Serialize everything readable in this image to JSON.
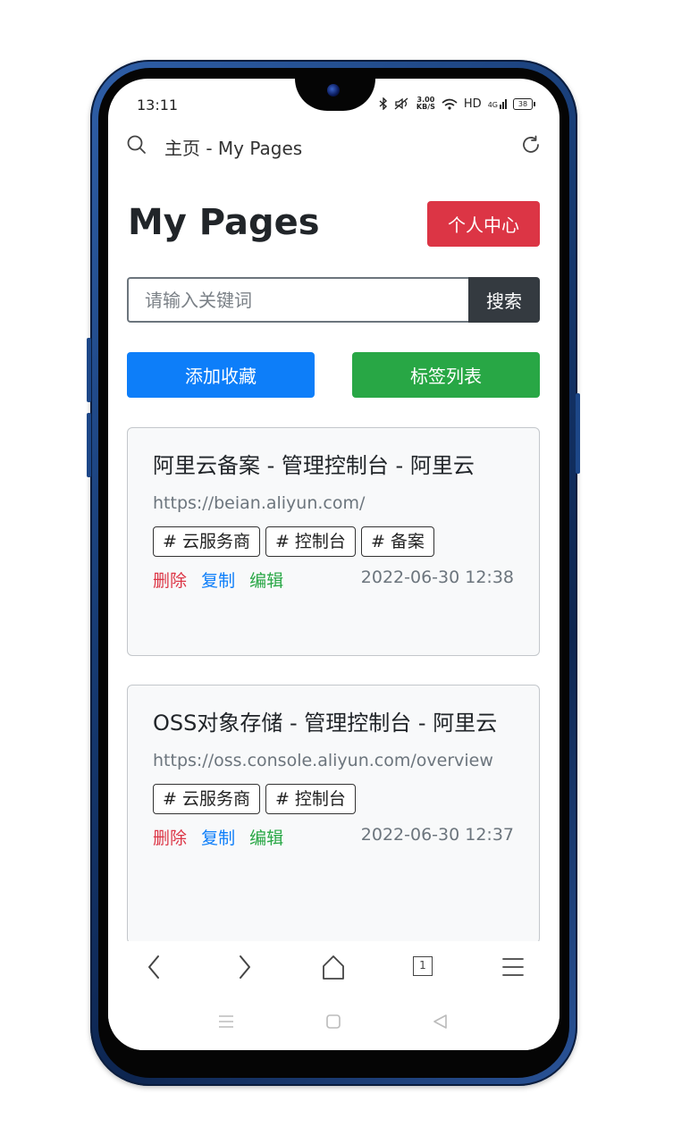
{
  "status_bar": {
    "time": "13:11",
    "speed_top": "3.00",
    "speed_bottom": "KB/S",
    "hd": "HD",
    "net": "4G",
    "battery": "38"
  },
  "browser": {
    "page_title": "主页 - My Pages"
  },
  "header": {
    "title": "My Pages",
    "user_center_label": "个人中心"
  },
  "search": {
    "placeholder": "请输入关键词",
    "button_label": "搜索"
  },
  "actions": {
    "add_label": "添加收藏",
    "tags_label": "标签列表"
  },
  "cards": [
    {
      "title": "阿里云备案 - 管理控制台 - 阿里云",
      "url": "https://beian.aliyun.com/",
      "tags": [
        "# 云服务商",
        "# 控制台",
        "# 备案"
      ],
      "delete_label": "删除",
      "copy_label": "复制",
      "edit_label": "编辑",
      "date": "2022-06-30 12:38"
    },
    {
      "title": "OSS对象存储 - 管理控制台 - 阿里云",
      "url": "https://oss.console.aliyun.com/overview",
      "tags": [
        "# 云服务商",
        "# 控制台"
      ],
      "delete_label": "删除",
      "copy_label": "复制",
      "edit_label": "编辑",
      "date": "2022-06-30 12:37"
    }
  ],
  "bottom_nav": {
    "tab_count": "1"
  },
  "colors": {
    "danger": "#dc3545",
    "primary": "#0d7ef9",
    "success": "#28a745",
    "dark": "#343a40"
  }
}
